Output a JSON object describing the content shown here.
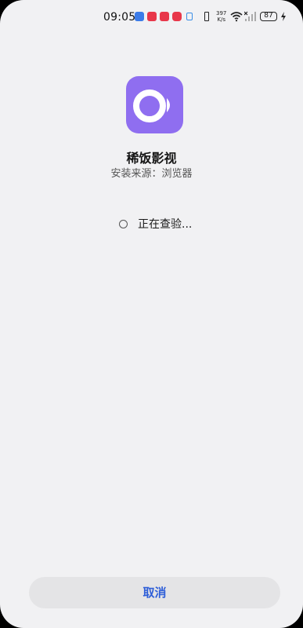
{
  "status_bar": {
    "time": "09:05",
    "speed_value": "397",
    "speed_unit": "K/s",
    "battery": "87"
  },
  "app": {
    "name": "稀饭影视",
    "source": "安装来源：浏览器",
    "accent_color": "#8f6ef0"
  },
  "status": {
    "checking_text": "正在查验..."
  },
  "actions": {
    "cancel_label": "取消"
  }
}
